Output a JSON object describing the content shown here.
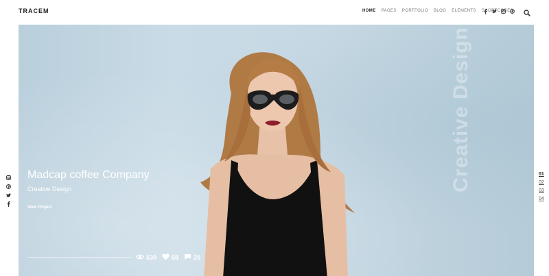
{
  "header": {
    "logo": "TRACEM",
    "nav": [
      {
        "label": "HOME",
        "active": true
      },
      {
        "label": "PAGES",
        "active": false
      },
      {
        "label": "PORTFOLIO",
        "active": false
      },
      {
        "label": "BLOG",
        "active": false
      },
      {
        "label": "ELEMENTS",
        "active": false
      },
      {
        "label": "SHORTCODES",
        "active": false
      }
    ],
    "social_icons": [
      "facebook-icon",
      "twitter-icon",
      "instagram-icon",
      "pinterest-icon"
    ],
    "search_icon": "search-icon"
  },
  "hero": {
    "title": "Madcap coffee Company",
    "subtitle": "Creative Design",
    "link": "View Project",
    "vertical_text": "Creative Design",
    "stats": {
      "views": "530",
      "likes": "68",
      "comments": "25"
    }
  },
  "side_social": [
    "instagram-icon",
    "pinterest-icon",
    "twitter-icon",
    "facebook-icon"
  ],
  "pager": [
    "01",
    "02",
    "03",
    "04"
  ],
  "colors": {
    "hero_bg": "#c6d8e3",
    "text_dark": "#222222",
    "white": "#ffffff"
  }
}
